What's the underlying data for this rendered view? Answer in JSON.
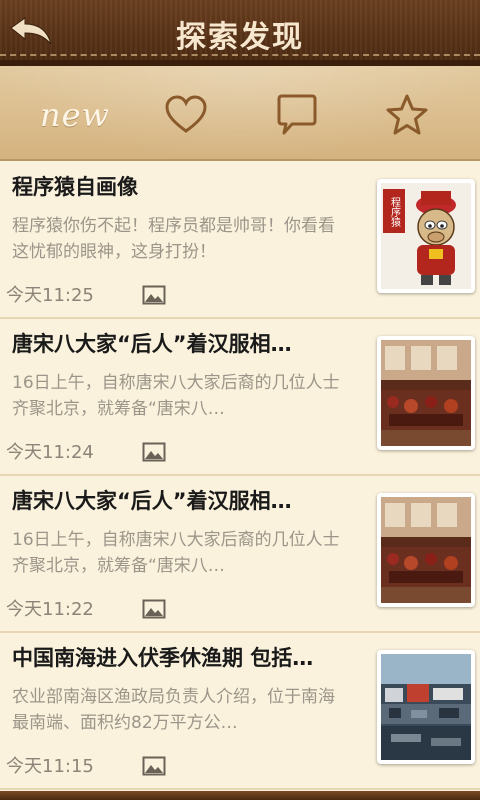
{
  "header": {
    "title": "探索发现",
    "back_icon": "back-arrow-icon"
  },
  "tabs": [
    {
      "label": "new",
      "icon": "new-text-icon"
    },
    {
      "label": "",
      "icon": "heart-icon"
    },
    {
      "label": "",
      "icon": "chat-bubble-icon"
    },
    {
      "label": "",
      "icon": "star-icon"
    }
  ],
  "colors": {
    "header_bg": "#5a3417",
    "tab_bg": "#dcbd8c",
    "list_bg": "#faf2dc",
    "title_text": "#1a1a1a",
    "desc_text": "#9c958a"
  },
  "items": [
    {
      "title": "程序猿自画像",
      "desc": "程序猿你伤不起！程序员都是帅哥！你看看这忧郁的眼神，这身打扮！",
      "time": "今天11:25",
      "thumb_label": "程序猿"
    },
    {
      "title": "唐宋八大家“后人”着汉服相…",
      "desc": "16日上午，自称唐宋八大家后裔的几位人士齐聚北京，就筹备“唐宋八…",
      "time": "今天11:24"
    },
    {
      "title": "唐宋八大家“后人”着汉服相…",
      "desc": "16日上午，自称唐宋八大家后裔的几位人士齐聚北京，就筹备“唐宋八…",
      "time": "今天11:22"
    },
    {
      "title": "中国南海进入伏季休渔期 包括…",
      "desc": "农业部南海区渔政局负责人介绍，位于南海最南端、面积约82万平方公…",
      "time": "今天11:15"
    }
  ]
}
